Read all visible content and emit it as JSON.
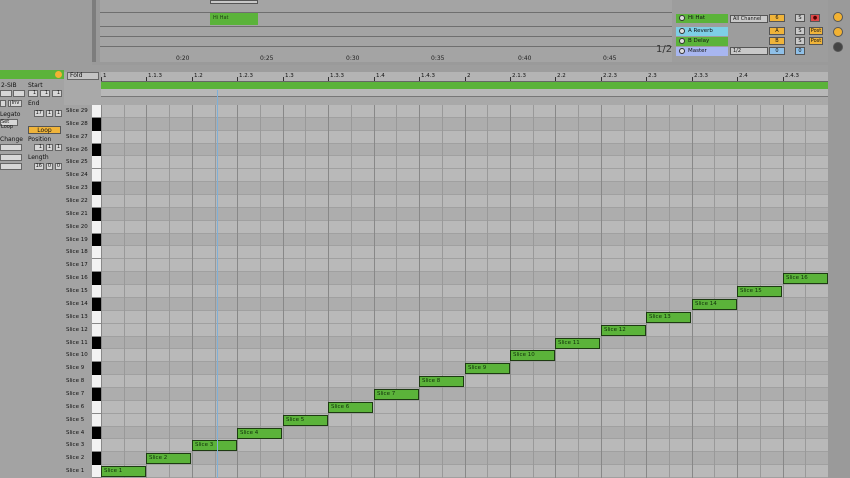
{
  "arrangement": {
    "clip_name": "Hi Hat",
    "timeline_labels": [
      "0:20",
      "0:25",
      "0:30",
      "0:35",
      "0:40",
      "0:45"
    ],
    "page_indicator": "1/2"
  },
  "mixer": {
    "tracks": [
      {
        "name": "Hi Hat",
        "color": "#5bb33a",
        "num": "6",
        "s": "S",
        "rec": "●"
      },
      {
        "name": "A Reverb",
        "color": "#7ecfe6",
        "num": "A",
        "s": "S",
        "post": "Post"
      },
      {
        "name": "B Delay",
        "color": "#5bb33a",
        "num": "B",
        "s": "S",
        "post": "Post"
      },
      {
        "name": "Master",
        "color": "#a8b6f0",
        "num": "0",
        "s": "0",
        "route": "1/2"
      }
    ],
    "input_select": "All Channel"
  },
  "clip_panel": {
    "labels": [
      "Start",
      "End",
      "Inv",
      "Legato",
      "Loop",
      "Position",
      "Length",
      "Change"
    ],
    "clip_file": "2-SIB",
    "start_values": [
      "1",
      "1",
      "1"
    ],
    "end_values": [
      "17",
      "1",
      "1"
    ],
    "position_values": [
      "1",
      "1",
      "1"
    ],
    "length_values": [
      "16",
      "0",
      "0"
    ],
    "set_loop": "Set Loop",
    "loop_button": "Loop"
  },
  "editor": {
    "fold_label": "Fold",
    "ruler_labels": [
      "1",
      "1.1.3",
      "1.2",
      "1.2.3",
      "1.3",
      "1.3.3",
      "1.4",
      "1.4.3",
      "2",
      "2.1.3",
      "2.2",
      "2.2.3",
      "2.3",
      "2.3.3",
      "2.4",
      "2.4.3"
    ],
    "key_labels": [
      "Slice 29",
      "Slice 28",
      "Slice 27",
      "Slice 26",
      "Slice 25",
      "Slice 24",
      "Slice 23",
      "Slice 22",
      "Slice 21",
      "Slice 20",
      "Slice 19",
      "Slice 18",
      "Slice 17",
      "Slice 16",
      "Slice 15",
      "Slice 14",
      "Slice 13",
      "Slice 12",
      "Slice 11",
      "Slice 10",
      "Slice 9",
      "Slice 8",
      "Slice 7",
      "Slice 6",
      "Slice 5",
      "Slice 4",
      "Slice 3",
      "Slice 2",
      "Slice 1"
    ],
    "notes": [
      {
        "label": "Slice 1",
        "slice": 1,
        "step": 0
      },
      {
        "label": "Slice 2",
        "slice": 2,
        "step": 1
      },
      {
        "label": "Slice 3",
        "slice": 3,
        "step": 2
      },
      {
        "label": "Slice 4",
        "slice": 4,
        "step": 3
      },
      {
        "label": "Slice 5",
        "slice": 5,
        "step": 4
      },
      {
        "label": "Slice 6",
        "slice": 6,
        "step": 5
      },
      {
        "label": "Slice 7",
        "slice": 7,
        "step": 6
      },
      {
        "label": "Slice 8",
        "slice": 8,
        "step": 7
      },
      {
        "label": "Slice 9",
        "slice": 9,
        "step": 8
      },
      {
        "label": "Slice 10",
        "slice": 10,
        "step": 9
      },
      {
        "label": "Slice 11",
        "slice": 11,
        "step": 10
      },
      {
        "label": "Slice 12",
        "slice": 12,
        "step": 11
      },
      {
        "label": "Slice 13",
        "slice": 13,
        "step": 12
      },
      {
        "label": "Slice 14",
        "slice": 14,
        "step": 13
      },
      {
        "label": "Slice 15",
        "slice": 15,
        "step": 14
      },
      {
        "label": "Slice 16",
        "slice": 16,
        "step": 15
      }
    ]
  }
}
